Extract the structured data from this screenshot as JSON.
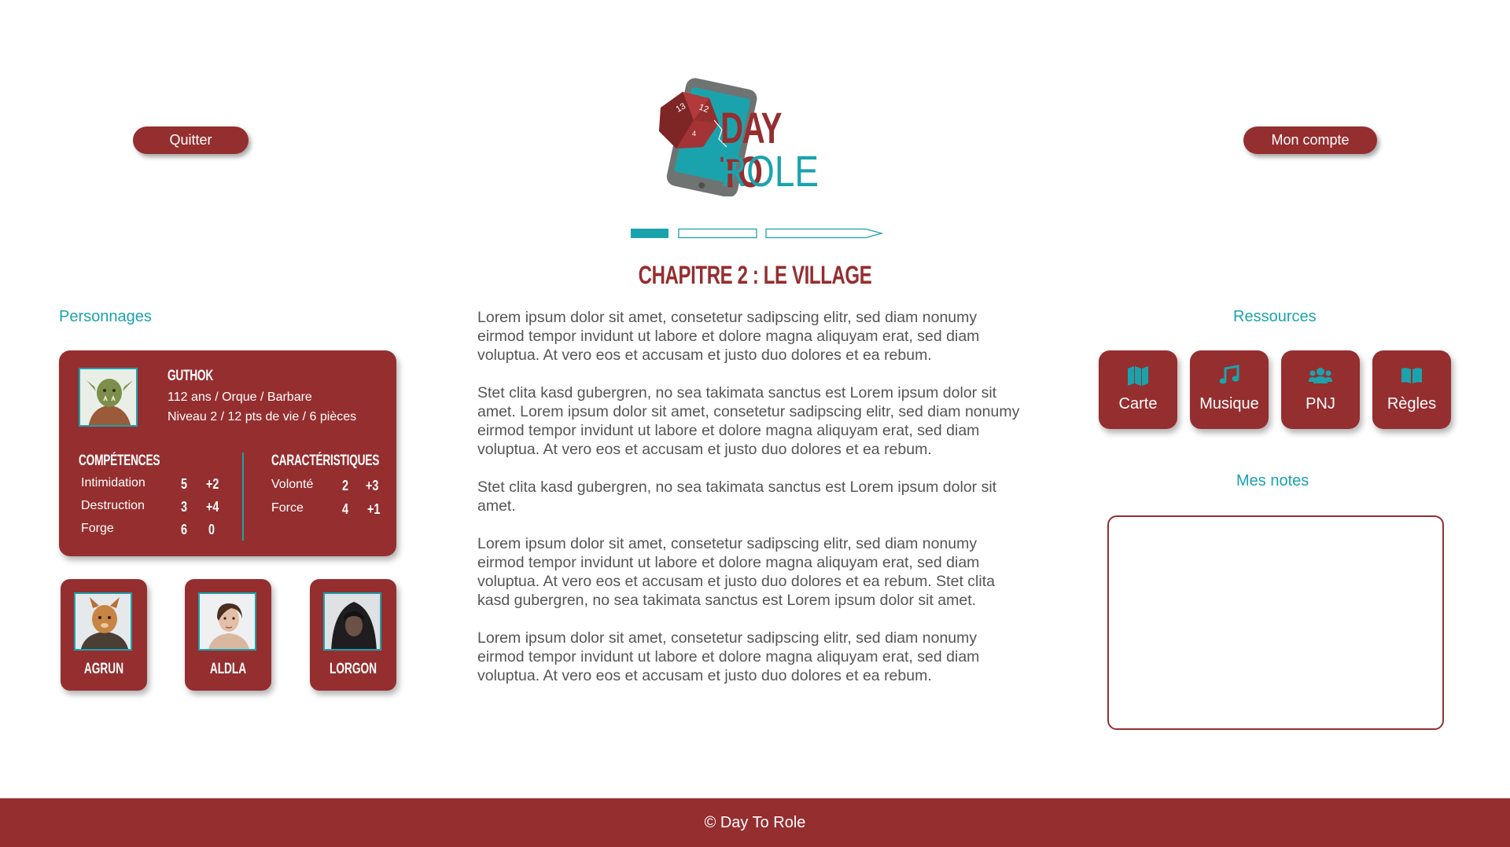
{
  "header": {
    "quit_label": "Quitter",
    "account_label": "Mon compte",
    "logo_line1": "DAY TO",
    "logo_line2": "ROLE"
  },
  "progress": {
    "steps": 3,
    "current": 1
  },
  "chapter_title": "CHAPITRE 2 : LE VILLAGE",
  "characters": {
    "section_label": "Personnages",
    "main": {
      "name": "GUTHOK",
      "line1": "112 ans  / Orque / Barbare",
      "line2": "Niveau 2 / 12 pts de vie / 6 pièces",
      "competences_title": "COMPÉTENCES",
      "competences": [
        {
          "name": "Intimidation",
          "value": "5",
          "bonus": "+2"
        },
        {
          "name": "Destruction",
          "value": "3",
          "bonus": "+4"
        },
        {
          "name": "Forge",
          "value": "6",
          "bonus": "0"
        }
      ],
      "caracteristiques_title": "CARACTÉRISTIQUES",
      "caracteristiques": [
        {
          "name": "Volonté",
          "value": "2",
          "bonus": "+3"
        },
        {
          "name": "Force",
          "value": "4",
          "bonus": "+1"
        }
      ]
    },
    "companions": [
      {
        "name": "AGRUN"
      },
      {
        "name": "ALDLA"
      },
      {
        "name": "LORGON"
      }
    ]
  },
  "story": [
    "Lorem ipsum dolor sit amet, consetetur sadipscing elitr, sed diam nonumy eirmod tempor invidunt ut labore et dolore magna aliquyam erat, sed diam voluptua. At vero eos et accusam et justo duo dolores et ea rebum.",
    "Stet clita kasd gubergren, no sea takimata sanctus est Lorem ipsum dolor sit amet. Lorem ipsum dolor sit amet, consetetur sadipscing elitr, sed diam nonumy eirmod tempor invidunt ut labore et dolore magna aliquyam erat, sed diam voluptua. At vero eos et accusam et justo duo dolores et ea rebum.",
    "Stet clita kasd gubergren, no sea takimata sanctus est Lorem ipsum dolor sit amet.",
    "Lorem ipsum dolor sit amet, consetetur sadipscing elitr, sed diam nonumy eirmod tempor invidunt ut labore et dolore magna aliquyam erat, sed diam voluptua. At vero eos et accusam et justo duo dolores et ea rebum. Stet clita kasd gubergren, no sea takimata sanctus est Lorem ipsum dolor sit amet.",
    "Lorem ipsum dolor sit amet, consetetur sadipscing elitr, sed diam nonumy eirmod tempor invidunt ut labore et dolore magna aliquyam erat, sed diam voluptua. At vero eos et accusam et justo duo dolores et ea rebum."
  ],
  "resources": {
    "section_label": "Ressources",
    "items": [
      {
        "label": "Carte",
        "icon": "map-icon"
      },
      {
        "label": "Musique",
        "icon": "music-icon"
      },
      {
        "label": "PNJ",
        "icon": "users-icon"
      },
      {
        "label": "Règles",
        "icon": "book-icon"
      }
    ]
  },
  "notes": {
    "section_label": "Mes notes",
    "value": ""
  },
  "footer": {
    "text": "© Day To Role"
  },
  "colors": {
    "primary": "#952e2f",
    "accent": "#1ba3ad"
  }
}
